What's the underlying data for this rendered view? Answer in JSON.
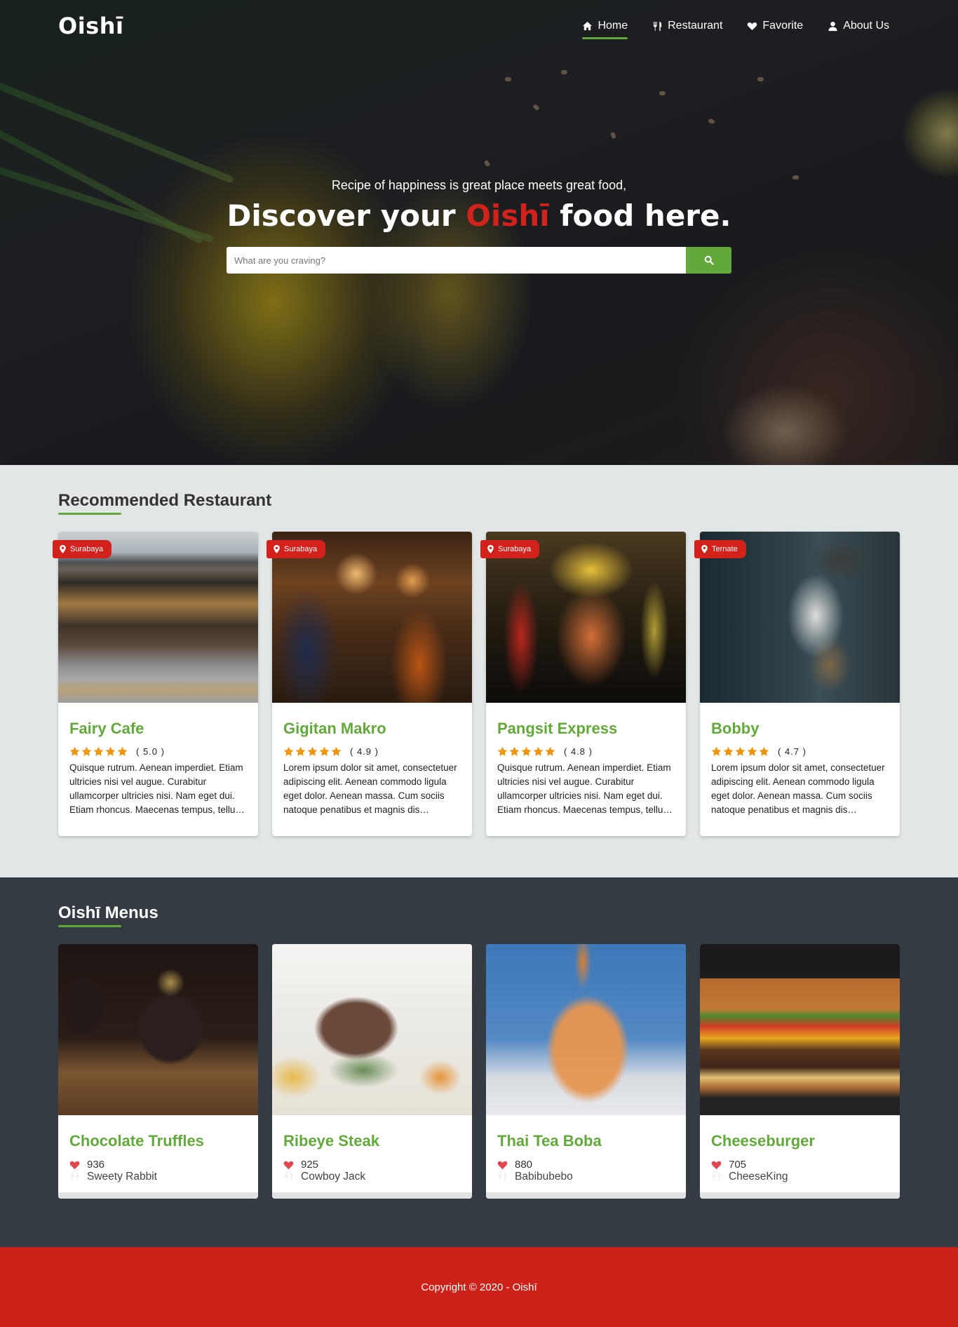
{
  "nav": {
    "brand": "Oishī",
    "items": [
      {
        "label": "Home",
        "icon": "home-icon",
        "active": true
      },
      {
        "label": "Restaurant",
        "icon": "utensils-icon",
        "active": false
      },
      {
        "label": "Favorite",
        "icon": "heart-icon",
        "active": false
      },
      {
        "label": "About Us",
        "icon": "user-icon",
        "active": false
      }
    ]
  },
  "hero": {
    "subtitle": "Recipe of happiness is great place meets great food,",
    "title_prefix": "Discover your ",
    "title_brand": "Oishī",
    "title_suffix": " food here.",
    "search_placeholder": "What are you craving?"
  },
  "restaurants": {
    "heading": "Recommended Restaurant",
    "items": [
      {
        "city": "Surabaya",
        "name": "Fairy Cafe",
        "rating": 5.0,
        "rating_text": "( 5.0 )",
        "stars": 5,
        "description": "Quisque rutrum. Aenean imperdiet. Etiam ultricies nisi vel augue. Curabitur ullamcorper ultricies nisi. Nam eget dui. Etiam rhoncus. Maecenas tempus, tellus eget condimentum rhoncus."
      },
      {
        "city": "Surabaya",
        "name": "Gigitan Makro",
        "rating": 4.9,
        "rating_text": "( 4.9 )",
        "stars": 5,
        "description": "Lorem ipsum dolor sit amet, consectetuer adipiscing elit. Aenean commodo ligula eget dolor. Aenean massa. Cum sociis natoque penatibus et magnis dis parturient montes."
      },
      {
        "city": "Surabaya",
        "name": "Pangsit Express",
        "rating": 4.8,
        "rating_text": "( 4.8 )",
        "stars": 5,
        "description": "Quisque rutrum. Aenean imperdiet. Etiam ultricies nisi vel augue. Curabitur ullamcorper ultricies nisi. Nam eget dui. Etiam rhoncus. Maecenas tempus, tellus eget condimentum rhoncus."
      },
      {
        "city": "Ternate",
        "name": "Bobby",
        "rating": 4.7,
        "rating_text": "( 4.7 )",
        "stars": 5,
        "description": "Lorem ipsum dolor sit amet, consectetuer adipiscing elit. Aenean commodo ligula eget dolor. Aenean massa. Cum sociis natoque penatibus et magnis dis parturient montes."
      }
    ]
  },
  "menus": {
    "heading": "Oishī Menus",
    "items": [
      {
        "name": "Chocolate Truffles",
        "likes": "936",
        "maker": "Sweety Rabbit"
      },
      {
        "name": "Ribeye Steak",
        "likes": "925",
        "maker": "Cowboy Jack"
      },
      {
        "name": "Thai Tea Boba",
        "likes": "880",
        "maker": "Babibubebo"
      },
      {
        "name": "Cheeseburger",
        "likes": "705",
        "maker": "CheeseKing"
      }
    ]
  },
  "footer": {
    "copyright": "Copyright © 2020 - Oishī"
  },
  "colors": {
    "accent_green": "#63a83a",
    "brand_red": "#d3221c",
    "star_orange": "#f0960e",
    "heart_red": "#e2474f",
    "menu_section_bg": "#353b43"
  }
}
